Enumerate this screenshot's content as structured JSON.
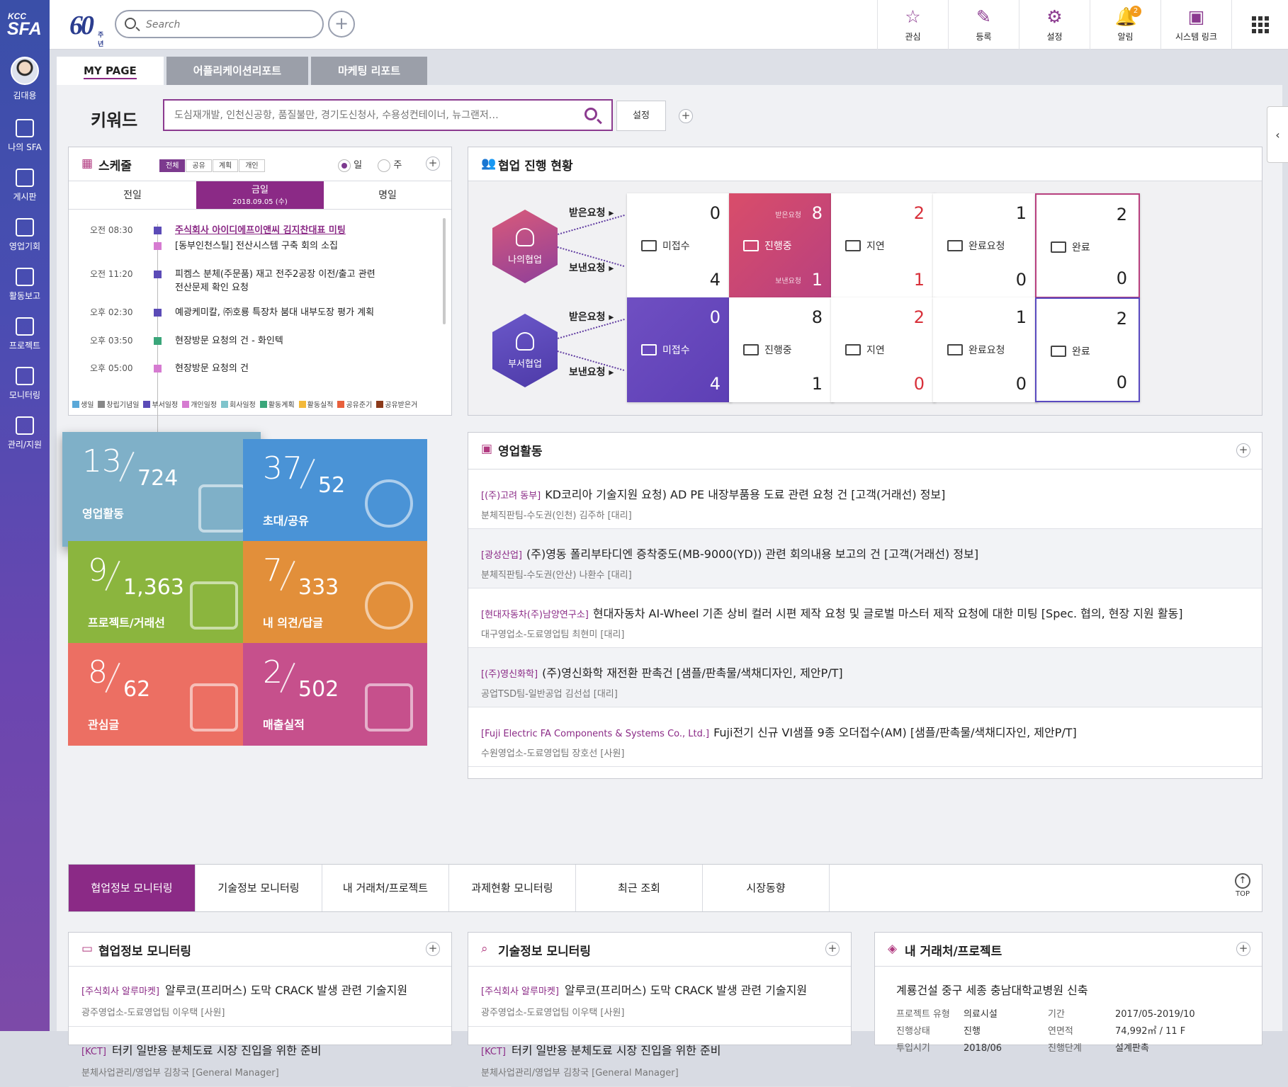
{
  "brand": {
    "kcc": "KCC",
    "sfa": "SFA",
    "anniv": "60",
    "anniv_sub": "주년"
  },
  "user": {
    "name": "김대용"
  },
  "nav": [
    {
      "label": "나의 SFA",
      "icon": "person-card-icon"
    },
    {
      "label": "게시판",
      "icon": "board-icon"
    },
    {
      "label": "영업기회",
      "icon": "lightbulb-icon"
    },
    {
      "label": "활동보고",
      "icon": "map-icon"
    },
    {
      "label": "프로젝트",
      "icon": "layers-icon"
    },
    {
      "label": "모니터링",
      "icon": "chart-icon"
    },
    {
      "label": "관리/지원",
      "icon": "window-icon"
    }
  ],
  "search": {
    "placeholder": "Search"
  },
  "topicons": [
    {
      "label": "관심",
      "glyph": "☆"
    },
    {
      "label": "등록",
      "glyph": "✎"
    },
    {
      "label": "설정",
      "glyph": "⚙"
    },
    {
      "label": "알림",
      "glyph": "🔔",
      "badge": "2"
    },
    {
      "label": "시스템 링크",
      "glyph": "▣"
    }
  ],
  "tabs": [
    "MY PAGE",
    "어플리케이션리포트",
    "마케팅 리포트"
  ],
  "keyword": {
    "label": "키워드",
    "placeholder": "도심재개발, 인천신공항, 품질불만, 경기도신청사, 수용성컨테이너, 뉴그랜저…",
    "set_label": "설정"
  },
  "schedule": {
    "title": "스케줄",
    "filters": [
      "전체",
      "공유",
      "계획",
      "개인"
    ],
    "radio_day": "일",
    "radio_week": "주",
    "prev": "전일",
    "today": "금일",
    "today_date": "2018.09.05 (수)",
    "next": "명일",
    "events": [
      {
        "time": "오전 08:30",
        "text": "주식회사 아이디에프이앤씨 김지찬대표 미팅",
        "color": "#5b4bb7",
        "highlight": true
      },
      {
        "time": "",
        "text": "[동부인천스틸] 전산시스템 구축 회의 소집",
        "color": "#d67bd1"
      },
      {
        "time": "오전 11:20",
        "text": "피켐스 분체(주문품) 재고 전주2공장 이전/출고 관련",
        "text2": "전산문제 확인 요청",
        "color": "#5b4bb7"
      },
      {
        "time": "오후 02:30",
        "text": "예광케미칼, ㈜호룡 특장차 붐대 내부도장 평가 계획",
        "color": "#5b4bb7"
      },
      {
        "time": "오후 03:50",
        "text": "현장방문 요청의 건 - 화인텍",
        "color": "#3aa67a"
      },
      {
        "time": "오후 05:00",
        "text": "현장방문 요청의 건",
        "color": "#d67bd1"
      }
    ],
    "legend": [
      {
        "label": "생일",
        "color": "#5aa8d8"
      },
      {
        "label": "창립기념일",
        "color": "#888888"
      },
      {
        "label": "부서일정",
        "color": "#5b4bb7"
      },
      {
        "label": "개인일정",
        "color": "#d67bd1"
      },
      {
        "label": "회사일정",
        "color": "#7fc4cc"
      },
      {
        "label": "활동계획",
        "color": "#3aa67a"
      },
      {
        "label": "활동실적",
        "color": "#f3b93a"
      },
      {
        "label": "공유준기",
        "color": "#e8603c"
      },
      {
        "label": "공유받은거",
        "color": "#8b3a1a"
      }
    ]
  },
  "collab": {
    "title": "협업 진행 현황",
    "received": "받은요청",
    "sent": "보낸요청",
    "rows": [
      {
        "name": "나의협업",
        "cards": [
          {
            "label": "미접수",
            "top": "0",
            "bottom": "4"
          },
          {
            "label": "진행중",
            "top": "8",
            "bottom": "1",
            "top_sub": "받은요청",
            "bottom_sub": "보낸요청"
          },
          {
            "label": "지연",
            "top": "2",
            "bottom": "1"
          },
          {
            "label": "완료요청",
            "top": "1",
            "bottom": "0"
          },
          {
            "label": "완료",
            "top": "2",
            "bottom": "0"
          }
        ]
      },
      {
        "name": "부서협업",
        "cards": [
          {
            "label": "미접수",
            "top": "0",
            "bottom": "4"
          },
          {
            "label": "진행중",
            "top": "8",
            "bottom": "1"
          },
          {
            "label": "지연",
            "top": "2",
            "bottom": "0"
          },
          {
            "label": "완료요청",
            "top": "1",
            "bottom": "0"
          },
          {
            "label": "완료",
            "top": "2",
            "bottom": "0"
          }
        ]
      }
    ]
  },
  "tiles": [
    {
      "big": "13",
      "small": "724",
      "label": "영업활동",
      "color": "#7fb0c8"
    },
    {
      "big": "37",
      "small": "52",
      "label": "초대/공유",
      "color": "#4a93d6"
    },
    {
      "big": "9",
      "small": "1,363",
      "label": "프로젝트/거래선",
      "color": "#8bb53e"
    },
    {
      "big": "7",
      "small": "333",
      "label": "내 의견/답글",
      "color": "#e28f3a"
    },
    {
      "big": "8",
      "small": "62",
      "label": "관심글",
      "color": "#ec6f63"
    },
    {
      "big": "2",
      "small": "502",
      "label": "매출실적",
      "color": "#c6508c"
    }
  ],
  "sales": {
    "title": "영업활동",
    "items": [
      {
        "company": "[(주)고려 동부]",
        "title": "KD코리아 기술지원 요청) AD PE 내장부품용 도료 관련 요청 건  [고객(거래선) 정보]",
        "sub": "분체직판팀-수도권(인천) 김주하 [대리]"
      },
      {
        "company": "[광성산업]",
        "title": "(주)영동 폴리부타디엔 증착중도(MB-9000(YD)) 관련 회의내용 보고의 건  [고객(거래선) 정보]",
        "sub": "분체직판팀-수도권(안산) 나환수 [대리]"
      },
      {
        "company": "[현대자동차(주)남양연구소]",
        "title": "현대자동차 AI-Wheel 기존 상비 컬러 시편 제작 요청 및 글로벌 마스터 제작 요청에 대한 미팅  [Spec. 협의, 현장 지원 활동]",
        "sub": "대구영업소-도료영업팀 최현미 [대리]"
      },
      {
        "company": "[(주)영신화학]",
        "title": "(주)영신화학 재전환 판촉건  [샘플/판촉물/색채디자인, 제안P/T]",
        "sub": "공업TSD팀-일반공업 김선섭 [대리]"
      },
      {
        "company": "[Fuji Electric FA Components & Systems Co., Ltd.]",
        "title": "Fuji전기 신규 VI샘플 9종 오더접수(AM)  [샘플/판촉물/색채디자인, 제안P/T]",
        "sub": "수원영업소-도료영업팀 장호선 [사원]"
      }
    ]
  },
  "bottom_tabs": [
    "협업정보 모니터링",
    "기술정보 모니터링",
    "내 거래처/프로젝트",
    "과제현황 모니터링",
    "최근 조회",
    "시장동향"
  ],
  "top_label": "TOP",
  "monitor1": {
    "title": "협업정보 모니터링",
    "items": [
      {
        "company": "[주식회사 알루마켓]",
        "title": "알루코(프리머스) 도막 CRACK 발생 관련 기술지원",
        "sub": "광주영업소-도료영업팀 이우택 [사원]"
      },
      {
        "company": "[KCT]",
        "title": "터키 일반용 분체도료 시장 진입을 위한 준비",
        "sub": "분체사업관리/영업부 김창국 [General Manager]"
      }
    ]
  },
  "monitor2": {
    "title": "기술정보 모니터링",
    "items": [
      {
        "company": "[주식회사 알루마켓]",
        "title": "알루코(프리머스) 도막 CRACK 발생 관련 기술지원",
        "sub": "광주영업소-도료영업팀 이우택 [사원]"
      },
      {
        "company": "[KCT]",
        "title": "터키 일반용 분체도료 시장 진입을 위한 준비",
        "sub": "분체사업관리/영업부 김창국 [General Manager]"
      }
    ]
  },
  "myproj": {
    "title": "내 거래처/프로젝트",
    "name": "계룡건설 중구 세종 충남대학교병원 신축",
    "fields": [
      {
        "k": "프로젝트 유형",
        "v": "의료시설"
      },
      {
        "k": "기간",
        "v": "2017/05-2019/10"
      },
      {
        "k": "진행상태",
        "v": "진행"
      },
      {
        "k": "연면적",
        "v": "74,992㎡ / 11 F"
      },
      {
        "k": "투입시기",
        "v": "2018/06"
      },
      {
        "k": "진행단계",
        "v": "설계판촉"
      }
    ]
  }
}
